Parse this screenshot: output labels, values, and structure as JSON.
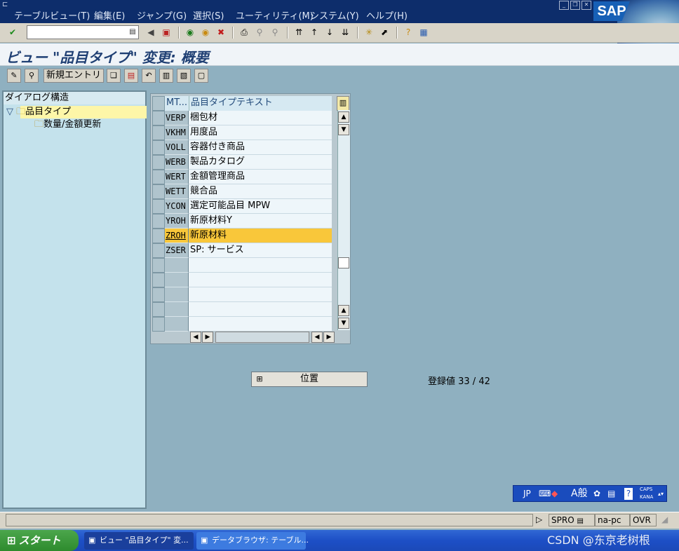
{
  "menubar": {
    "items": [
      "テーブルビュー(T)",
      "編集(E)",
      "ジャンプ(G)",
      "選択(S)",
      "ユーティリティ(M)",
      "システム(Y)",
      "ヘルプ(H)"
    ],
    "logo": "SAP"
  },
  "toolbar": {
    "command_field_value": ""
  },
  "title": "ビュー \"品目タイプ\" 変更: 概要",
  "app_toolbar": {
    "new_entry_label": "新規エントリ"
  },
  "tree": {
    "header": "ダイアログ構造",
    "items": [
      {
        "label": "品目タイプ",
        "level": 0,
        "expanded": true,
        "selected": true
      },
      {
        "label": "数量/金額更新",
        "level": 1,
        "expanded": false,
        "selected": false
      }
    ]
  },
  "table": {
    "columns": [
      "MT...",
      "品目タイプテキスト"
    ],
    "rows": [
      {
        "key": "VERP",
        "text": "梱包材"
      },
      {
        "key": "VKHM",
        "text": "用度品"
      },
      {
        "key": "VOLL",
        "text": "容器付き商品"
      },
      {
        "key": "WERB",
        "text": "製品カタログ"
      },
      {
        "key": "WERT",
        "text": "金額管理商品"
      },
      {
        "key": "WETT",
        "text": "競合品"
      },
      {
        "key": "YCON",
        "text": "選定可能品目 MPW"
      },
      {
        "key": "YROH",
        "text": "新原材料Y"
      },
      {
        "key": "ZROH",
        "text": "新原材料",
        "highlighted": true
      },
      {
        "key": "ZSER",
        "text": "SP: サービス"
      }
    ],
    "empty_rows": 5
  },
  "position_button": "位置",
  "entry_count": "登録値 33 / 42",
  "ime": {
    "lang": "JP",
    "mode": "A般",
    "caps": "CAPS",
    "kana": "KANA"
  },
  "status": {
    "transaction": "SPRO",
    "host": "na-pc",
    "mode": "OVR"
  },
  "taskbar": {
    "start": "スタート",
    "tasks": [
      "ビュー \"品目タイプ\" 変...",
      "データブラウザ: テーブル..."
    ]
  },
  "watermark": "CSDN @东京老树根"
}
